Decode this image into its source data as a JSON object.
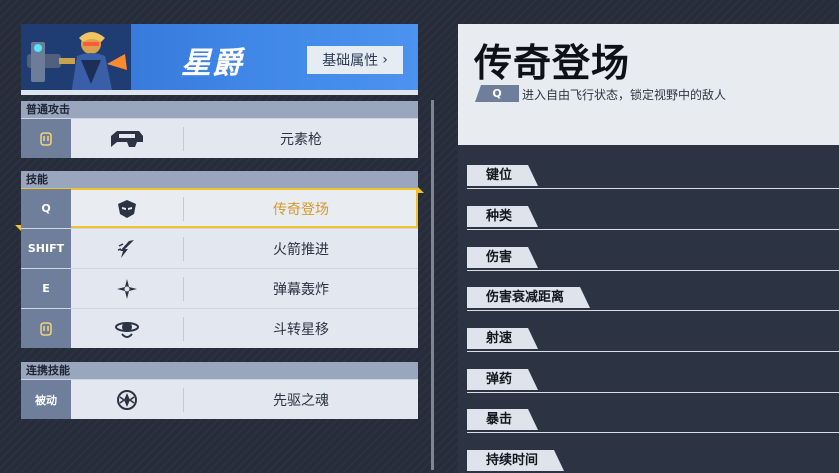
{
  "hero": {
    "name": "星爵",
    "attr_button": "基础属性",
    "attr_chevron": "›"
  },
  "sections": {
    "basic": {
      "header": "普通攻击",
      "rows": [
        {
          "key_icon": "mouse-icon",
          "icon": "blaster-gun-icon",
          "label": "元素枪"
        }
      ]
    },
    "skills": {
      "header": "技能",
      "rows": [
        {
          "key": "Q",
          "icon": "legend-mask-icon",
          "label": "传奇登场",
          "selected": true
        },
        {
          "key": "SHIFT",
          "icon": "rocket-boost-icon",
          "label": "火箭推进"
        },
        {
          "key": "E",
          "icon": "bullet-barrage-icon",
          "label": "弹幕轰炸"
        },
        {
          "key_icon": "mouse-icon",
          "icon": "star-swap-icon",
          "label": "斗转星移"
        }
      ]
    },
    "combo": {
      "header": "连携技能",
      "rows": [
        {
          "key": "被动",
          "icon": "vanguard-soul-icon",
          "label": "先驱之魂"
        }
      ]
    }
  },
  "detail": {
    "title": "传奇登场",
    "key": "Q",
    "description": "进入自由飞行状态，锁定视野中的敌人",
    "stats": [
      "键位",
      "种类",
      "伤害",
      "伤害衰减距离",
      "射速",
      "弹药",
      "暴击",
      "持续时间"
    ]
  },
  "colors": {
    "accent_selected": "#f2c12e",
    "selected_text": "#d39a2c",
    "banner_blue": "#3f86e6",
    "key_cell": "#6f7f9b"
  }
}
